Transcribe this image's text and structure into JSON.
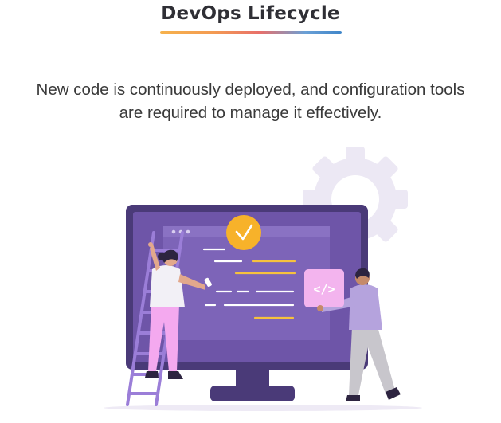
{
  "header": {
    "title": "DevOps Lifecycle"
  },
  "body": {
    "subtitle_line1": "New code is continuously deployed, and configuration tools",
    "subtitle_line2": "are required to manage it effectively."
  },
  "illustration": {
    "icons": [
      "gear-icon",
      "check-icon",
      "code-tag-icon"
    ],
    "code_tag": "</>",
    "colors": {
      "monitor_frame": "#4a3a78",
      "monitor_screen": "#6e55a8",
      "code_window": "#7d64b8",
      "check_badge": "#f7b22a",
      "code_card": "#f3b4ee",
      "gear": "#ece8f4",
      "ladder": "#9b7ed8",
      "woman_pants": "#f4a9ef",
      "man_shirt": "#b5a3dd",
      "man_pants": "#c8c6cc"
    }
  }
}
